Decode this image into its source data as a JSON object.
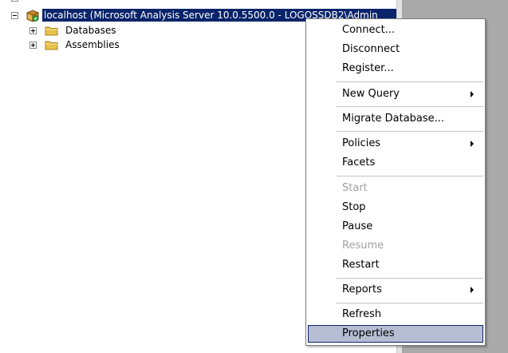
{
  "tree": {
    "server_label": "localhost (Microsoft Analysis Server 10.0.5500.0 - LOGOSSDB2\\Admin",
    "children": [
      "Databases",
      "Assemblies"
    ]
  },
  "context_menu": {
    "items": [
      {
        "label": "Connect...",
        "enabled": true,
        "submenu": false
      },
      {
        "label": "Disconnect",
        "enabled": true,
        "submenu": false
      },
      {
        "label": "Register...",
        "enabled": true,
        "submenu": false
      },
      {
        "label": "New Query",
        "enabled": true,
        "submenu": true
      },
      {
        "label": "Migrate Database...",
        "enabled": true,
        "submenu": false
      },
      {
        "label": "Policies",
        "enabled": true,
        "submenu": true
      },
      {
        "label": "Facets",
        "enabled": true,
        "submenu": false
      },
      {
        "label": "Start",
        "enabled": false,
        "submenu": false
      },
      {
        "label": "Stop",
        "enabled": true,
        "submenu": false
      },
      {
        "label": "Pause",
        "enabled": true,
        "submenu": false
      },
      {
        "label": "Resume",
        "enabled": false,
        "submenu": false
      },
      {
        "label": "Restart",
        "enabled": true,
        "submenu": false
      },
      {
        "label": "Reports",
        "enabled": true,
        "submenu": true
      },
      {
        "label": "Refresh",
        "enabled": true,
        "submenu": false
      },
      {
        "label": "Properties",
        "enabled": true,
        "submenu": false,
        "highlighted": true
      }
    ]
  },
  "colors": {
    "selection": "#0a246a",
    "menu_highlight": "#b6bdd2",
    "disabled_text": "#a0a0a0",
    "right_pane": "#a9a9a9"
  }
}
